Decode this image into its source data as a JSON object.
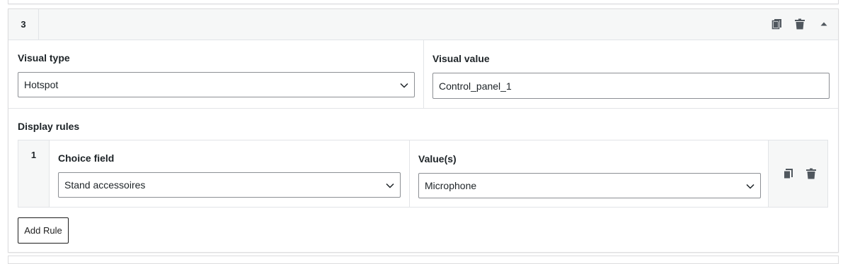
{
  "row": {
    "number": "3"
  },
  "header_icons": {
    "duplicate": "duplicate-icon",
    "delete": "trash-icon",
    "collapse": "caret-up-icon"
  },
  "fields": {
    "visual_type": {
      "label": "Visual type",
      "value": "Hotspot"
    },
    "visual_value": {
      "label": "Visual value",
      "value": "Control_panel_1"
    }
  },
  "display_rules": {
    "label": "Display rules",
    "rules": [
      {
        "number": "1",
        "choice_field": {
          "label": "Choice field",
          "value": "Stand accessoires"
        },
        "values": {
          "label": "Value(s)",
          "value": "Microphone"
        }
      }
    ],
    "add_button": "Add Rule"
  },
  "colors": {
    "border": "#dcdcde",
    "header_bg": "#f6f7f7",
    "text": "#1d2327",
    "icon": "#50575e"
  }
}
